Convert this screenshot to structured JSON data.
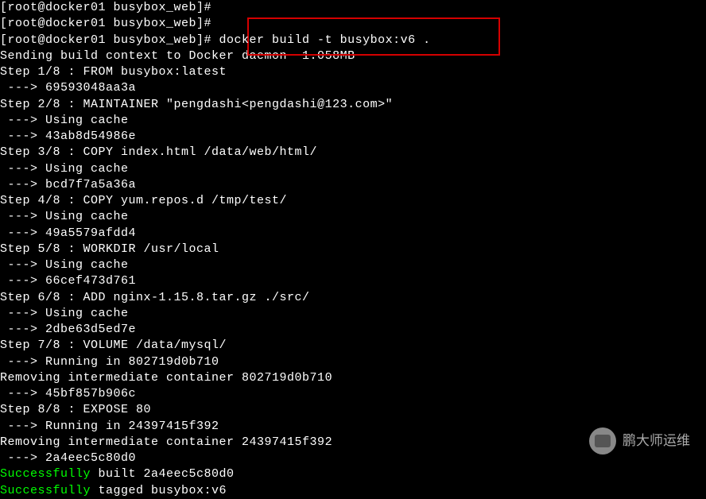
{
  "terminal": {
    "lines": [
      {
        "text": "[root@docker01 busybox_web]#",
        "class": ""
      },
      {
        "text": "[root@docker01 busybox_web]#",
        "class": ""
      },
      {
        "text": "[root@docker01 busybox_web]# docker build -t busybox:v6 .",
        "class": ""
      },
      {
        "text": "Sending build context to Docker daemon  1.058MB",
        "class": ""
      },
      {
        "text": "Step 1/8 : FROM busybox:latest",
        "class": ""
      },
      {
        "text": " ---> 69593048aa3a",
        "class": ""
      },
      {
        "text": "Step 2/8 : MAINTAINER \"pengdashi<pengdashi@123.com>\"",
        "class": ""
      },
      {
        "text": " ---> Using cache",
        "class": ""
      },
      {
        "text": " ---> 43ab8d54986e",
        "class": ""
      },
      {
        "text": "Step 3/8 : COPY index.html /data/web/html/",
        "class": ""
      },
      {
        "text": " ---> Using cache",
        "class": ""
      },
      {
        "text": " ---> bcd7f7a5a36a",
        "class": ""
      },
      {
        "text": "Step 4/8 : COPY yum.repos.d /tmp/test/",
        "class": ""
      },
      {
        "text": " ---> Using cache",
        "class": ""
      },
      {
        "text": " ---> 49a5579afdd4",
        "class": ""
      },
      {
        "text": "Step 5/8 : WORKDIR /usr/local",
        "class": ""
      },
      {
        "text": " ---> Using cache",
        "class": ""
      },
      {
        "text": " ---> 66cef473d761",
        "class": ""
      },
      {
        "text": "Step 6/8 : ADD nginx-1.15.8.tar.gz ./src/",
        "class": ""
      },
      {
        "text": " ---> Using cache",
        "class": ""
      },
      {
        "text": " ---> 2dbe63d5ed7e",
        "class": ""
      },
      {
        "text": "Step 7/8 : VOLUME /data/mysql/",
        "class": ""
      },
      {
        "text": " ---> Running in 802719d0b710",
        "class": ""
      },
      {
        "text": "Removing intermediate container 802719d0b710",
        "class": ""
      },
      {
        "text": " ---> 45bf857b906c",
        "class": ""
      },
      {
        "text": "Step 8/8 : EXPOSE 80",
        "class": ""
      },
      {
        "text": " ---> Running in 24397415f392",
        "class": ""
      },
      {
        "text": "Removing intermediate container 24397415f392",
        "class": ""
      },
      {
        "text": " ---> 2a4eec5c80d0",
        "class": ""
      }
    ],
    "success_lines": [
      {
        "prefix": "Successfully",
        "rest": " built 2a4eec5c80d0"
      },
      {
        "prefix": "Successfully",
        "rest": " tagged busybox:v6"
      }
    ]
  },
  "watermark": {
    "text": "鹏大师运维"
  }
}
